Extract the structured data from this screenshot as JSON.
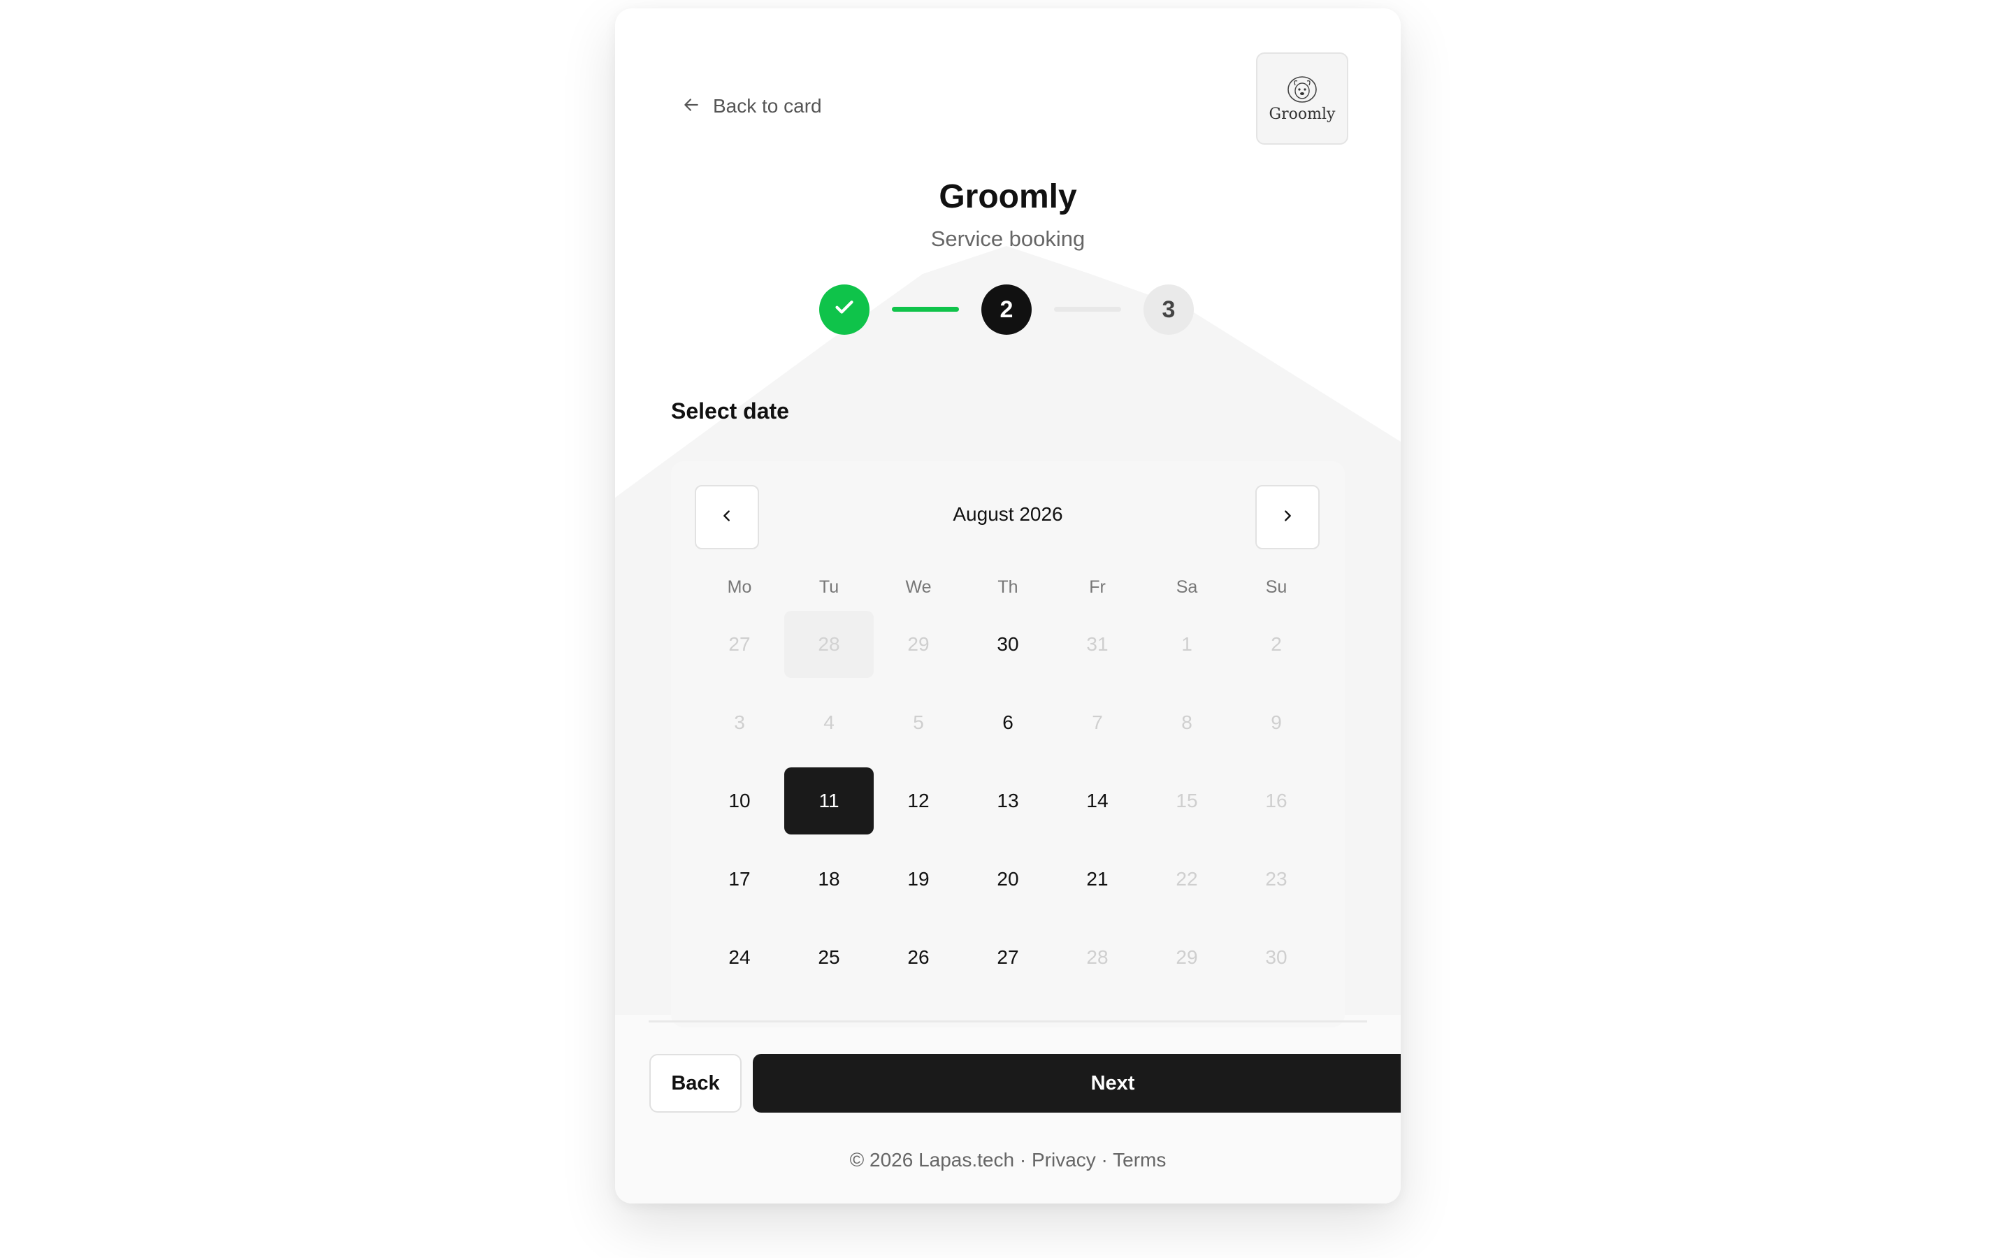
{
  "header": {
    "back_label": "Back to card",
    "logo_text": "Groomly",
    "title": "Groomly",
    "subtitle": "Service booking"
  },
  "steps": [
    {
      "number": "1",
      "status": "completed"
    },
    {
      "number": "2",
      "status": "current"
    },
    {
      "number": "3",
      "status": "upcoming"
    }
  ],
  "section_title": "Select date",
  "calendar": {
    "month_label": "August 2026",
    "weekdays": [
      "Mo",
      "Tu",
      "We",
      "Th",
      "Fr",
      "Sa",
      "Su"
    ],
    "days": [
      {
        "label": "27",
        "state": "disabled"
      },
      {
        "label": "28",
        "state": "muted"
      },
      {
        "label": "29",
        "state": "disabled"
      },
      {
        "label": "30",
        "state": "avail"
      },
      {
        "label": "31",
        "state": "disabled"
      },
      {
        "label": "1",
        "state": "disabled"
      },
      {
        "label": "2",
        "state": "disabled"
      },
      {
        "label": "3",
        "state": "disabled"
      },
      {
        "label": "4",
        "state": "disabled"
      },
      {
        "label": "5",
        "state": "disabled"
      },
      {
        "label": "6",
        "state": "avail"
      },
      {
        "label": "7",
        "state": "disabled"
      },
      {
        "label": "8",
        "state": "disabled"
      },
      {
        "label": "9",
        "state": "disabled"
      },
      {
        "label": "10",
        "state": "avail"
      },
      {
        "label": "11",
        "state": "selected"
      },
      {
        "label": "12",
        "state": "avail"
      },
      {
        "label": "13",
        "state": "avail"
      },
      {
        "label": "14",
        "state": "avail"
      },
      {
        "label": "15",
        "state": "disabled"
      },
      {
        "label": "16",
        "state": "disabled"
      },
      {
        "label": "17",
        "state": "avail"
      },
      {
        "label": "18",
        "state": "avail"
      },
      {
        "label": "19",
        "state": "avail"
      },
      {
        "label": "20",
        "state": "avail"
      },
      {
        "label": "21",
        "state": "avail"
      },
      {
        "label": "22",
        "state": "disabled"
      },
      {
        "label": "23",
        "state": "disabled"
      },
      {
        "label": "24",
        "state": "avail"
      },
      {
        "label": "25",
        "state": "avail"
      },
      {
        "label": "26",
        "state": "avail"
      },
      {
        "label": "27",
        "state": "avail"
      },
      {
        "label": "28",
        "state": "disabled"
      },
      {
        "label": "29",
        "state": "disabled"
      },
      {
        "label": "30",
        "state": "disabled"
      }
    ]
  },
  "actions": {
    "back_label": "Back",
    "next_label": "Next"
  },
  "footer": {
    "copyright": "© 2026 Lapas.tech",
    "separator": " · ",
    "privacy": "Privacy",
    "terms": "Terms"
  },
  "colors": {
    "accent_green": "#0fc34a",
    "primary_dark": "#1a1a1a"
  },
  "icons": {
    "back": "arrow-left-icon",
    "prev_month": "chevron-left-icon",
    "next_month": "chevron-right-icon",
    "step_done": "checkmark-icon",
    "logo": "dog-logo-icon"
  }
}
